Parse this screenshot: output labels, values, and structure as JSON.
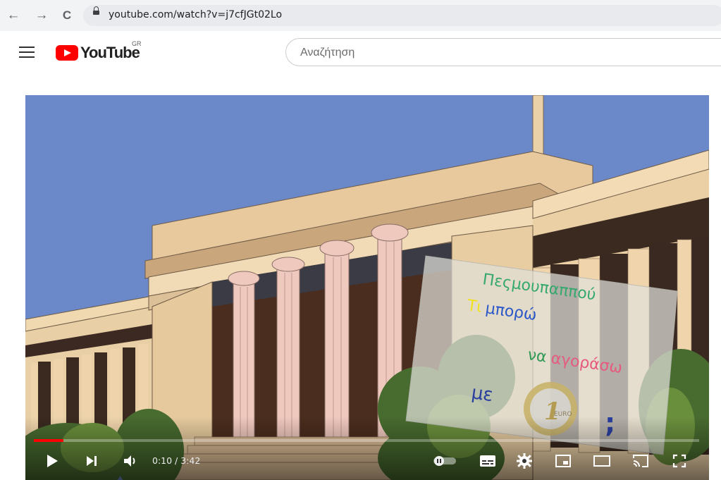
{
  "browser": {
    "url": "youtube.com/watch?v=j7cfJGt02Lo",
    "icons": [
      "back-icon",
      "forward-icon",
      "reload-icon",
      "lock-icon"
    ],
    "glyphs": {
      "back": "←",
      "forward": "→",
      "reload": "C"
    }
  },
  "header": {
    "brand": "YouTube",
    "country_code": "GR",
    "search_placeholder": "Αναζήτηση"
  },
  "player": {
    "card_text": {
      "line1": "Πεςμουπαππού",
      "line2_a": "Τι",
      "line2_b": "μπορώ",
      "line3_a": "να",
      "line3_b": "αγοράσω",
      "line4": "με",
      "question_mark": ";",
      "coin_value": "1",
      "coin_label": "EURO"
    },
    "progress_fraction": 0.045,
    "time": "0:10 / 3:42",
    "accent_color": "#ff0000"
  }
}
